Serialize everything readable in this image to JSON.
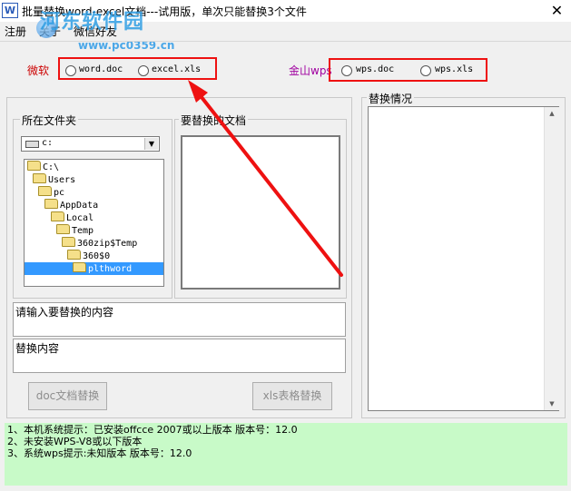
{
  "window": {
    "title": "批量替换word-excel文档---试用版，单次只能替换3个文件",
    "app_icon_text": "W",
    "close_glyph": "✕"
  },
  "watermark": {
    "main": "河东软件园",
    "url": "www.pc0359.cn"
  },
  "menu": {
    "items": [
      "注册",
      "关于",
      "微信好友"
    ]
  },
  "office_options": {
    "label": "微软",
    "label_color": "#cc0000",
    "option1": "word.doc",
    "option2": "excel.xls"
  },
  "wps_options": {
    "label": "金山wps",
    "label_color": "#a000a0",
    "option1": "wps.doc",
    "option2": "wps.xls"
  },
  "folder_group": {
    "title": "所在文件夹",
    "drive": "c:",
    "tree": [
      {
        "label": "C:\\",
        "selected": false
      },
      {
        "label": "Users",
        "selected": false
      },
      {
        "label": "pc",
        "selected": false
      },
      {
        "label": "AppData",
        "selected": false
      },
      {
        "label": "Local",
        "selected": false
      },
      {
        "label": "Temp",
        "selected": false
      },
      {
        "label": "360zip$Temp",
        "selected": false
      },
      {
        "label": "360$0",
        "selected": false
      },
      {
        "label": "plthword",
        "selected": true
      }
    ]
  },
  "docs_group": {
    "title": "要替换的文档"
  },
  "results_group": {
    "title": "替换情况"
  },
  "inputs": {
    "find_text": "请输入要替换的内容",
    "replace_text": "替换内容"
  },
  "buttons": {
    "doc_replace": "doc文档替换",
    "xls_replace": "xls表格替换"
  },
  "status": {
    "lines": [
      "1、本机系统提示：已安装offcce 2007或以上版本 版本号：12.0",
      "2、未安装WPS-V8或以下版本",
      "3、系统wps提示:未知版本 版本号：12.0"
    ],
    "background": "#c8fac8"
  },
  "annotation": {
    "box_color": "#ee1111",
    "arrow_color": "#ee1111"
  }
}
